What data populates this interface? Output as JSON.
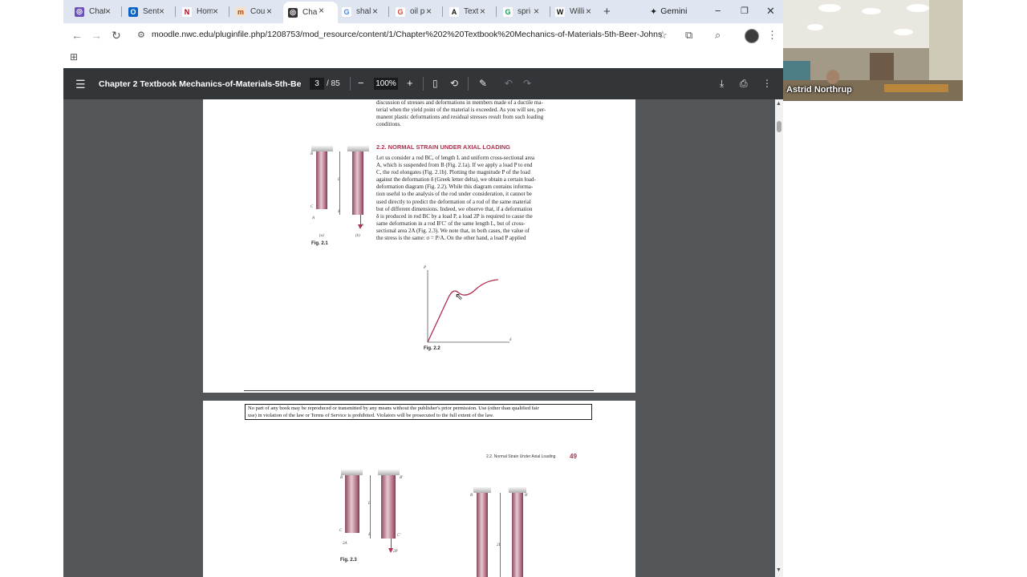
{
  "tabs": [
    {
      "label": "Chat",
      "icon": "chatgpt-icon",
      "fav": "◎",
      "color": "#6b4fbb",
      "text_color": "#ffffff"
    },
    {
      "label": "Sent",
      "icon": "outlook-icon",
      "fav": "O",
      "color": "#0a64c8",
      "text_color": "#ffffff"
    },
    {
      "label": "Hom",
      "icon": "netflix-icon",
      "fav": "N",
      "color": "#ffffff",
      "text_color": "#b00020"
    },
    {
      "label": "Cou",
      "icon": "course-icon",
      "fav": "m",
      "color": "#f6e0c8",
      "text_color": "#a8461a"
    },
    {
      "label": "Cha",
      "icon": "chatgpt-icon",
      "fav": "◎",
      "color": "#333333",
      "text_color": "#ffffff"
    },
    {
      "label": "shal",
      "icon": "google-icon",
      "fav": "G",
      "color": "#ffffff",
      "text_color": "#4285f4"
    },
    {
      "label": "oil p",
      "icon": "google-icon",
      "fav": "G",
      "color": "#ffffff",
      "text_color": "#db4437"
    },
    {
      "label": "Text",
      "icon": "anthropic-icon",
      "fav": "A",
      "color": "#ffffff",
      "text_color": "#111111"
    },
    {
      "label": "spri",
      "icon": "google-icon",
      "fav": "G",
      "color": "#ffffff",
      "text_color": "#0f9d58"
    },
    {
      "label": "Willi",
      "icon": "wikipedia-icon",
      "fav": "W",
      "color": "#ffffff",
      "text_color": "#111111"
    }
  ],
  "active_tab_index": 4,
  "new_tab_label": "+",
  "gemini_label": "Gemini",
  "window_controls": {
    "minimize": "−",
    "restore": "❐",
    "close": "✕"
  },
  "url": "moodle.nwc.edu/pluginfile.php/1208753/mod_resource/content/1/Chapter%202%20Textbook%20Mechanics-of-Materials-5th-Beer-Johnston....",
  "pdf": {
    "title": "Chapter 2 Textbook Mechanics-of-Materials-5th-Beer-...",
    "current_page": "3",
    "total_pages": "/ 85",
    "zoom": "100%",
    "zoom_out": "−",
    "zoom_in": "+"
  },
  "page1": {
    "top_lines": [
      "discussion of stresses and deformations in members made of a ductile ma-",
      "terial when the yield point of the material is exceeded. As you will see, per-",
      "manent plastic deformations and residual stresses result from such loading",
      "conditions."
    ],
    "section_heading": "2.2. NORMAL STRAIN UNDER AXIAL LOADING",
    "body_lines": [
      "Let us consider a rod BC, of length L and uniform cross-sectional area",
      "A, which is suspended from B (Fig. 2.1a). If we apply a load P to end",
      "C, the rod elongates (Fig. 2.1b). Plotting the magnitude P of the load",
      "against the deformation δ (Greek letter delta), we obtain a certain load-",
      "deformation diagram (Fig. 2.2). While this diagram contains informa-",
      "tion useful to the analysis of the rod under consideration, it cannot be",
      "used directly to predict the deformation of a rod of the same material",
      "but of different dimensions. Indeed, we observe that, if a deformation",
      "δ is produced in rod BC by a load P, a load 2P is required to cause the",
      "same deformation in a rod B′C′ of the same length L, but of cross-",
      "sectional area 2A (Fig. 2.3). We note that, in both cases, the value of",
      "the stress is the same: σ = P/A. On the other hand, a load P applied"
    ],
    "fig21_caption": "Fig. 2.1",
    "fig21_sub_a": "(a)",
    "fig21_sub_b": "(b)",
    "fig22_caption": "Fig. 2.2",
    "fig22_axis_y": "P",
    "fig22_axis_x": "δ"
  },
  "page2": {
    "notice_lines": [
      "No part of any book may be reproduced or transmitted by any means without the publisher's prior permission.  Use (other than qualified fair",
      "use) in violation of the law or Terms of Service is prohibited. Violators will be prosecuted to the full extent of the law."
    ],
    "running_head": "2.2. Normal Strain Under Axial Loading",
    "page_number": "49",
    "fig23_caption": "Fig. 2.3",
    "label_2A": "2A",
    "label_2L": "2L"
  },
  "figure_labels": {
    "B": "B",
    "C": "C",
    "L": "L",
    "delta": "δ",
    "P": "P",
    "A": "A",
    "Bp": "B′",
    "Cp": "C′",
    "twoP": "2P"
  },
  "webcam": {
    "name": "Astrid Northrup"
  }
}
